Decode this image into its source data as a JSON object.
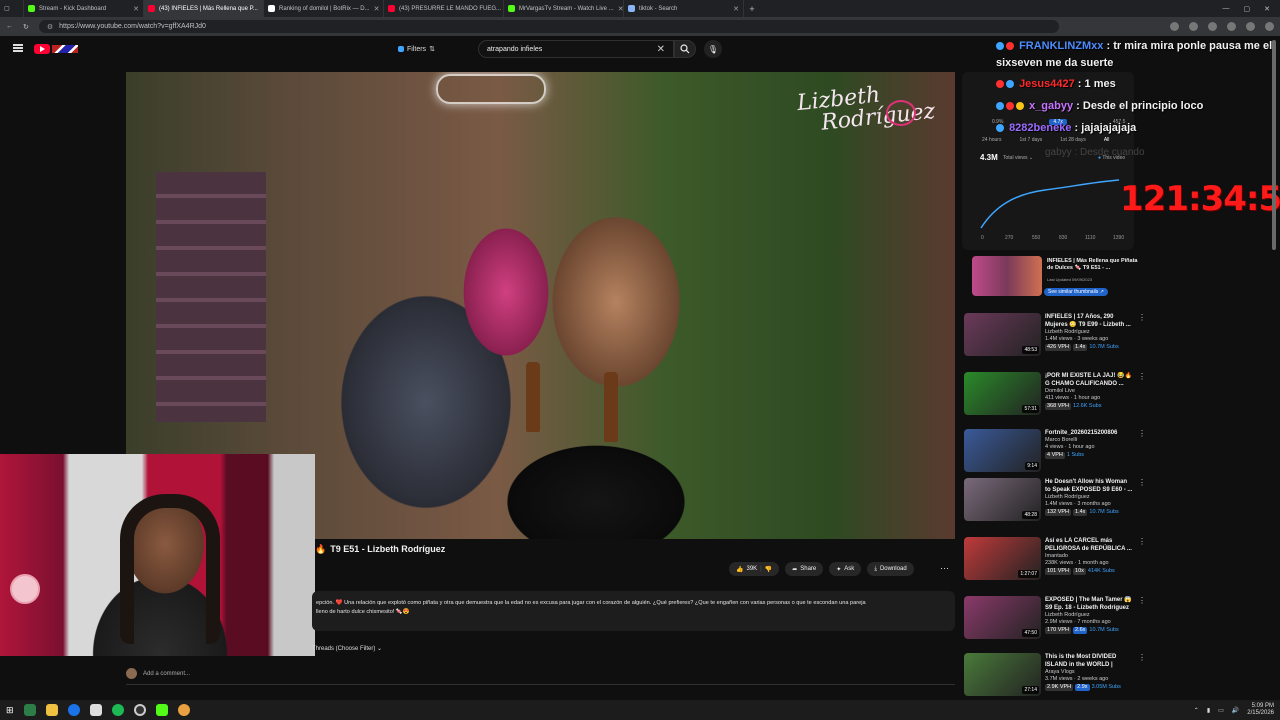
{
  "browser": {
    "tabs": [
      {
        "label": "Stream - Kick Dashboard",
        "color": "#53fc18"
      },
      {
        "label": "(43) INFIELES | Más Rellena que P...",
        "color": "#ff0033"
      },
      {
        "label": "Ranking of domilol | BotRix — D...",
        "color": "#ffffff"
      },
      {
        "label": "(43) PRESURRE LE MANDO FUEG...",
        "color": "#ff0033"
      },
      {
        "label": "MrVargasTv Stream - Watch Live ...",
        "color": "#53fc18"
      },
      {
        "label": "tiktok - Search",
        "color": "#8ab4f8"
      }
    ],
    "url": "https://www.youtube.com/watch?v=gffXA4RJd0"
  },
  "youtube": {
    "filters_label": "Filters",
    "search_query": "atrapando infieles",
    "video_title": "T9 E51 - Lizbeth Rodríguez",
    "likes": "39K",
    "share_label": "Share",
    "ask_label": "Ask",
    "download_label": "Download",
    "description_line1": "epción. ❤️ Una relación que explotó como piñata y otra que demuestra que la edad no es excusa para jugar con el corazón de alguién. ¿Qué prefieres? ¿Que te engañen con varias personas o que te escondan una pareja",
    "description_line2": "lleno de harto dulce chismesito! 🍬😍",
    "threads_label": "Threads (Choose Filter)",
    "comment_placeholder": "Add a comment...",
    "video_logo_line1": "Lizbeth",
    "video_logo_line2": "Rodríguez"
  },
  "stats_overlay": {
    "views_total": "4.3M",
    "views_label": "Total views",
    "this_video": "This video",
    "ranges": [
      "24 hours",
      "1st 7 days",
      "1st 28 days",
      "All"
    ],
    "x_ticks": [
      "0",
      "270",
      "550",
      "830",
      "1110",
      "1390"
    ],
    "vals": [
      "0.9%",
      "4.7x",
      "457.5"
    ],
    "featured_title": "INFIELES | Más Rellena que Piñata de Dulces 🍬 T9 E51 - ...",
    "featured_sub": "Last Updated 09/09/2023",
    "featured_btn": "See similar thumbnails"
  },
  "timer": "121:34:53",
  "chat": [
    {
      "user": "FRANKLINZMxx",
      "text": "tr mira mira ponle pausa me el sixseven me da suerte",
      "color": "#4d8cff"
    },
    {
      "user": "Jesus4427",
      "text": "1 mes",
      "color": "#ff2a2a"
    },
    {
      "user": "x_gabyy",
      "text": "Desde el principio loco",
      "color": "#c774ff"
    },
    {
      "user": "8282beneke",
      "text": "jajajajajaja",
      "color": "#9c6bff"
    }
  ],
  "chat_ghost": "gabyy : Desde cuando",
  "recommendations": [
    {
      "title": "INFIELES | 17 Años, 290 Mujeres 😳 T9 E99 - Lizbeth ...",
      "channel": "Lizbeth Rodríguez",
      "meta": "1.4M views · 3 weeks ago",
      "vph": "426 VPH",
      "mult": "1.4x",
      "subs": "10.7M Subs",
      "duration": "48:53",
      "bg": "#6b3a5a"
    },
    {
      "title": "¡POR MI EXISTE LA JAJ! 😂🔥 G CHAMO CALIFICANDO ...",
      "channel": "Domilol Live",
      "meta": "411 views · 1 hour ago",
      "vph": "368 VPH",
      "mult": "",
      "subs": "12.6K Subs",
      "duration": "57:31",
      "bg": "#2a8a2a"
    },
    {
      "title": "Fortnite_20260215200806",
      "channel": "Marco Borelli",
      "meta": "4 views · 1 hour ago",
      "vph": "4 VPH",
      "mult": "",
      "subs": "1 Subs",
      "duration": "9:14",
      "bg": "#3a5a9a"
    },
    {
      "title": "He Doesn't Allow his Woman to Speak EXPOSED S9 E60 - ...",
      "channel": "Lizbeth Rodríguez",
      "meta": "1.4M views · 3 months ago",
      "vph": "132 VPH",
      "mult": "1.4x",
      "subs": "10.7M Subs",
      "duration": "48:28",
      "bg": "#7a6a7a"
    },
    {
      "title": "Así es LA CÁRCEL más PELIGROSA de REPÚBLICA ...",
      "channel": "Imantado",
      "meta": "238K views · 1 month ago",
      "vph": "101 VPH",
      "mult": "10x",
      "subs": "414K Subs",
      "duration": "1:27:07",
      "bg": "#c03a3a"
    },
    {
      "title": "EXPOSED | The Man Tamer 😱 S9 Ep. 18 - Lizbeth Rodríguez",
      "channel": "Lizbeth Rodríguez",
      "meta": "2.9M views · 7 months ago",
      "vph": "170 VPH",
      "mult": "2.6x",
      "subs": "10.7M Subs",
      "duration": "47:50",
      "bg": "#8a3a6a"
    },
    {
      "title": "This is the Most DIVIDED ISLAND in the WORLD | Haiti-...",
      "channel": "Araya Vlogs",
      "meta": "3.7M views · 2 weeks ago",
      "vph": "2.9K VPH",
      "mult": "2.9x",
      "subs": "3.05M Subs",
      "duration": "27:14",
      "bg": "#4a7a3a"
    }
  ],
  "taskbar": {
    "time": "5:09 PM",
    "date": "2/15/2026"
  },
  "colors": {
    "accent": "#ff0033",
    "timer": "#ff1a1a",
    "chart_line": "#3ea6ff"
  }
}
